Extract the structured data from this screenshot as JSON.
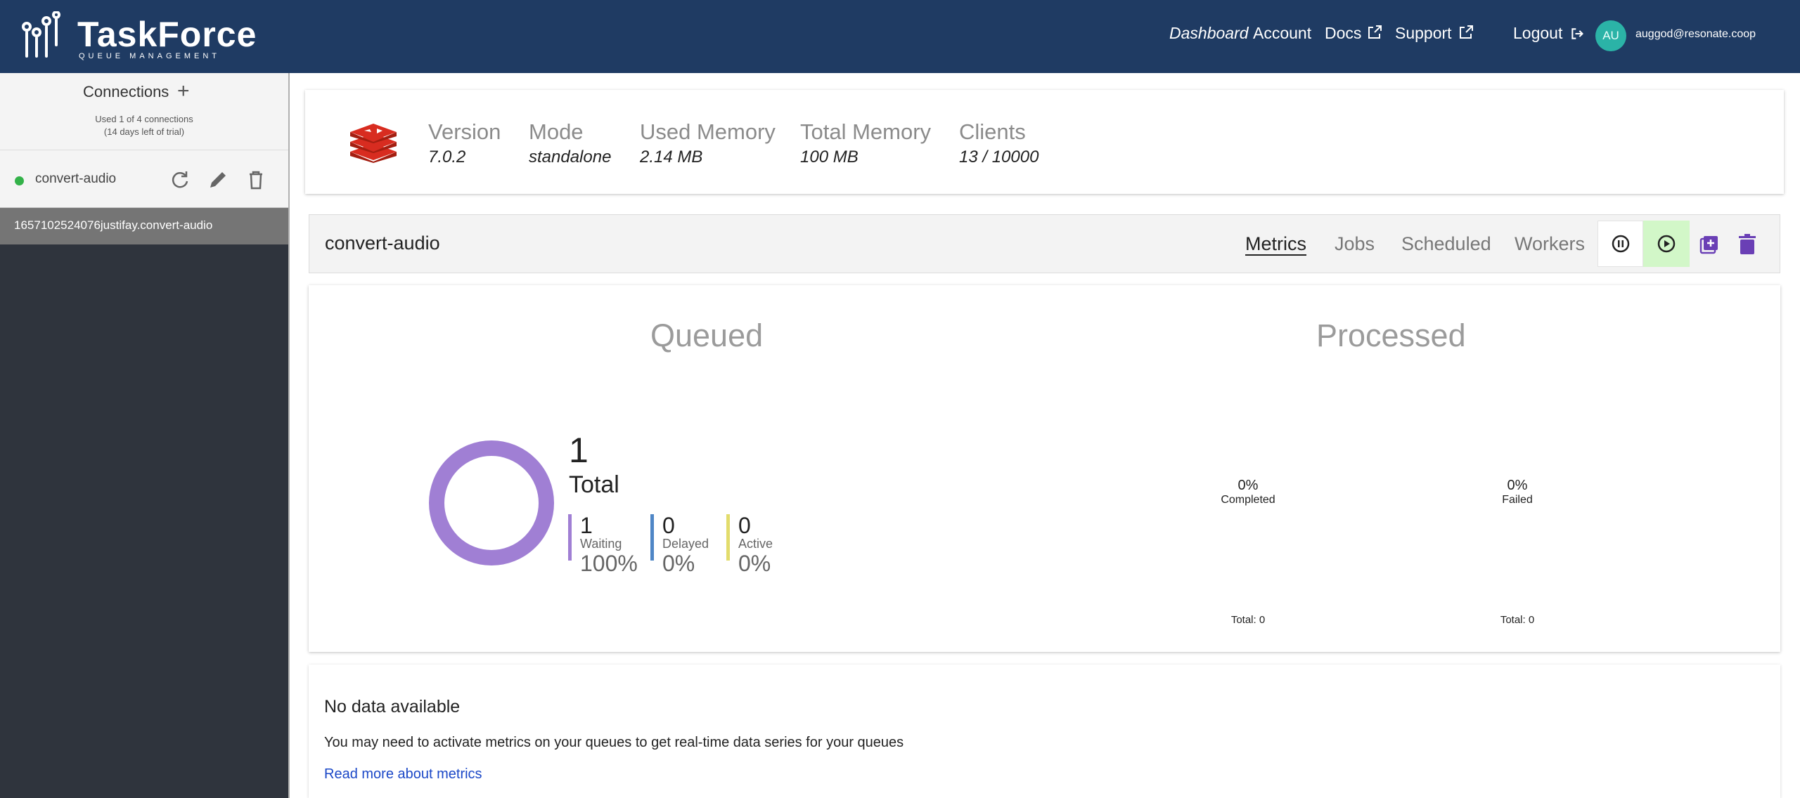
{
  "header": {
    "logo_text": "TaskForce",
    "logo_subtitle": "QUEUE MANAGEMENT",
    "nav": {
      "dashboard": "Dashboard",
      "account": "Account",
      "docs": "Docs",
      "support": "Support",
      "logout": "Logout"
    },
    "avatar_initials": "AU",
    "user_email": "auggod@resonate.coop"
  },
  "sidebar": {
    "title": "Connections",
    "usage": "Used 1 of 4 connections",
    "trial": "(14 days left of trial)",
    "connection": {
      "name": "convert-audio",
      "status_color": "#33b249"
    },
    "queues": [
      "1657102524076justifay.convert-audio"
    ]
  },
  "redis_info": {
    "stats": [
      {
        "label": "Version",
        "value": "7.0.2"
      },
      {
        "label": "Mode",
        "value": "standalone"
      },
      {
        "label": "Used Memory",
        "value": "2.14 MB"
      },
      {
        "label": "Total Memory",
        "value": "100 MB"
      },
      {
        "label": "Clients",
        "value": "13 / 10000"
      }
    ]
  },
  "queue": {
    "name": "convert-audio",
    "tabs": {
      "metrics": "Metrics",
      "jobs": "Jobs",
      "scheduled": "Scheduled",
      "workers": "Workers"
    },
    "active_tab": "Metrics"
  },
  "metrics": {
    "queued": {
      "title": "Queued",
      "total": "1",
      "total_label": "Total",
      "waiting": {
        "count": "1",
        "label": "Waiting",
        "pct": "100%"
      },
      "delayed": {
        "count": "0",
        "label": "Delayed",
        "pct": "0%"
      },
      "active": {
        "count": "0",
        "label": "Active",
        "pct": "0%"
      }
    },
    "processed": {
      "title": "Processed",
      "completed": {
        "pct": "0%",
        "label": "Completed",
        "total": "Total: 0"
      },
      "failed": {
        "pct": "0%",
        "label": "Failed",
        "total": "Total: 0"
      }
    }
  },
  "no_data": {
    "title": "No data available",
    "text": "You may need to activate metrics on your queues to get real-time data series for your queues",
    "link": "Read more about metrics"
  },
  "colors": {
    "header_bg": "#1f3b63",
    "sidebar_bg": "#2f343d",
    "waiting": "#a07fd4",
    "delayed": "#4f86c6",
    "active": "#e2dc6c",
    "action_purple": "#6a3fb5",
    "resume_bg": "#d2f7c8"
  }
}
